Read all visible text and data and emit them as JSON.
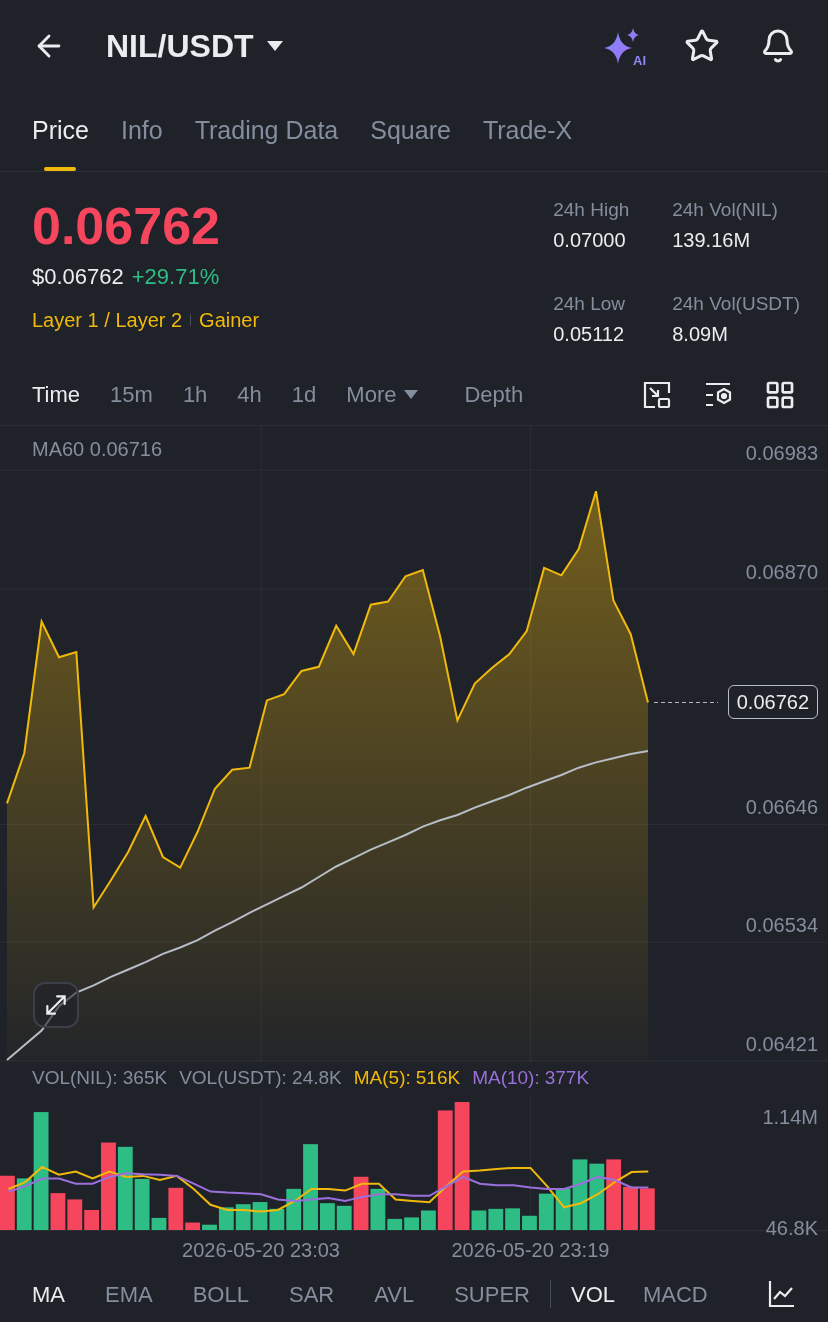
{
  "header": {
    "title": "NIL/USDT",
    "ai_badge": "AI"
  },
  "tabs": [
    {
      "label": "Price",
      "selected": true
    },
    {
      "label": "Info",
      "selected": false
    },
    {
      "label": "Trading Data",
      "selected": false
    },
    {
      "label": "Square",
      "selected": false
    },
    {
      "label": "Trade-X",
      "selected": false
    }
  ],
  "ticker": {
    "price": "0.06762",
    "usd_price": "$0.06762",
    "change": "+29.71%",
    "tags": [
      "Layer 1 / Layer 2",
      "Gainer"
    ],
    "stats": [
      {
        "label": "24h High",
        "value": "0.07000"
      },
      {
        "label": "24h Vol(NIL)",
        "value": "139.16M"
      },
      {
        "label": "24h Low",
        "value": "0.05112"
      },
      {
        "label": "24h Vol(USDT)",
        "value": "8.09M"
      }
    ]
  },
  "intervals": [
    {
      "label": "Time",
      "kind": "option",
      "selected": true
    },
    {
      "label": "15m",
      "kind": "option",
      "selected": false
    },
    {
      "label": "1h",
      "kind": "option",
      "selected": false
    },
    {
      "label": "4h",
      "kind": "option",
      "selected": false
    },
    {
      "label": "1d",
      "kind": "option",
      "selected": false
    },
    {
      "label": "More",
      "kind": "dropdown",
      "selected": false
    },
    {
      "label": "Depth",
      "kind": "option",
      "selected": false
    }
  ],
  "price_chart": {
    "ma_value": "0.06716",
    "current_price": "0.06762",
    "chart_data": {
      "type": "area",
      "grid": true,
      "series": [
        {
          "type": "area",
          "color": "#f0b90b",
          "values": [
            0.06666,
            0.06714,
            0.06839,
            0.06805,
            0.0681,
            0.06567,
            0.06593,
            0.0662,
            0.06654,
            0.06615,
            0.06605,
            0.06639,
            0.0668,
            0.06698,
            0.067,
            0.06764,
            0.0677,
            0.06792,
            0.06796,
            0.06835,
            0.06808,
            0.06855,
            0.06858,
            0.06882,
            0.06888,
            0.06825,
            0.06745,
            0.0678,
            0.06795,
            0.06808,
            0.0683,
            0.0689,
            0.06883,
            0.06908,
            0.06963,
            0.06859,
            0.06827,
            0.06762
          ]
        },
        {
          "name": "MA60",
          "type": "line",
          "color": "#b7bdc6",
          "values": [
            0.06422,
            0.06436,
            0.0645,
            0.06473,
            0.06486,
            0.06493,
            0.06501,
            0.06508,
            0.06515,
            0.06523,
            0.06529,
            0.06536,
            0.06545,
            0.06553,
            0.06562,
            0.0657,
            0.06578,
            0.06586,
            0.06596,
            0.06606,
            0.06614,
            0.06622,
            0.06629,
            0.06636,
            0.06644,
            0.0665,
            0.06655,
            0.06662,
            0.06668,
            0.06674,
            0.06681,
            0.06687,
            0.06693,
            0.067,
            0.06705,
            0.06709,
            0.06713,
            0.06716
          ]
        }
      ],
      "ylim": [
        0.06421,
        0.07025
      ],
      "yticks": [
        {
          "value": 0.06983,
          "label": "0.06983"
        },
        {
          "value": 0.0687,
          "label": "0.06870"
        },
        {
          "value": 0.06646,
          "label": "0.06646"
        },
        {
          "value": 0.06534,
          "label": "0.06534"
        },
        {
          "value": 0.06421,
          "label": "0.06421"
        }
      ]
    }
  },
  "volume": {
    "legend": [
      "VOL(NIL): 365K",
      "VOL(USDT): 24.8K"
    ],
    "ma_readings": [
      "516K",
      "377K"
    ],
    "chart_data": {
      "type": "bar",
      "stacked": true,
      "categories": [
        null,
        null,
        null,
        null,
        null,
        null,
        null,
        null,
        null,
        null,
        null,
        null,
        null,
        null,
        null,
        "2026-05-20 23:03",
        null,
        null,
        null,
        null,
        null,
        null,
        null,
        null,
        null,
        null,
        null,
        null,
        null,
        null,
        null,
        "2026-05-20 23:19",
        null,
        null,
        null,
        null,
        null,
        null,
        null
      ],
      "series": [
        {
          "type": "bar",
          "color": "#2ebd85",
          "values": [
            null,
            555000,
            1208000,
            null,
            null,
            null,
            null,
            866000,
            550000,
            166000,
            null,
            null,
            99000,
            270000,
            301000,
            322000,
            255000,
            452000,
            892000,
            311000,
            285000,
            null,
            452000,
            156000,
            171000,
            239000,
            null,
            null,
            239000,
            255000,
            260000,
            187000,
            405000,
            457000,
            742000,
            700000,
            null,
            null,
            null
          ]
        },
        {
          "type": "bar",
          "color": "#f6465d",
          "values": [
            581000,
            null,
            null,
            410000,
            348000,
            244000,
            908000,
            null,
            null,
            null,
            462000,
            120000,
            null,
            null,
            null,
            null,
            null,
            null,
            null,
            null,
            null,
            571000,
            null,
            null,
            null,
            null,
            1224000,
            1307000,
            null,
            null,
            null,
            null,
            null,
            null,
            null,
            null,
            742000,
            472000,
            457000
          ]
        },
        {
          "name": "MA(5):",
          "type": "line",
          "color": "#f0b90b",
          "values": [
            451000,
            518000,
            668000,
            591000,
            622000,
            554000,
            622000,
            570000,
            580000,
            539000,
            580000,
            451000,
            295000,
            244000,
            244000,
            228000,
            244000,
            332000,
            451000,
            451000,
            435000,
            503000,
            503000,
            347000,
            332000,
            321000,
            477000,
            622000,
            632000,
            648000,
            658000,
            658000,
            477000,
            270000,
            311000,
            399000,
            518000,
            617000,
            622000
          ]
        },
        {
          "name": "MA(10):",
          "type": "line",
          "color": "#9b6fdc",
          "values": [
            425000,
            477000,
            554000,
            554000,
            503000,
            503000,
            570000,
            606000,
            596000,
            591000,
            580000,
            503000,
            425000,
            415000,
            409000,
            399000,
            347000,
            332000,
            347000,
            363000,
            332000,
            373000,
            399000,
            399000,
            384000,
            384000,
            477000,
            570000,
            503000,
            487000,
            487000,
            466000,
            451000,
            451000,
            503000,
            570000,
            539000,
            466000,
            466000
          ]
        }
      ],
      "ylim": [
        46800,
        1386000
      ],
      "yticks": [
        {
          "value": 1140000,
          "label": "1.14M"
        },
        {
          "value": 46800,
          "label": "46.8K"
        }
      ]
    }
  },
  "main_indicators": [
    {
      "label": "MA",
      "selected": true
    },
    {
      "label": "EMA",
      "selected": false
    },
    {
      "label": "BOLL",
      "selected": false
    },
    {
      "label": "SAR",
      "selected": false
    },
    {
      "label": "AVL",
      "selected": false
    },
    {
      "label": "SUPER",
      "selected": false
    }
  ],
  "sub_indicators": [
    {
      "label": "VOL",
      "selected": true
    },
    {
      "label": "MACD",
      "selected": false
    }
  ]
}
